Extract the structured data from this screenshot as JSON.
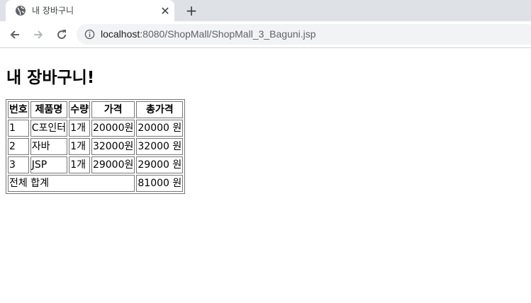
{
  "browser": {
    "tab": {
      "title": "내 장바구니"
    },
    "url": {
      "host": "localhost",
      "rest": ":8080/ShopMall/ShopMall_3_Baguni.jsp"
    }
  },
  "page": {
    "heading": "내 장바구니!",
    "table": {
      "headers": [
        "번호",
        "제품명",
        "수량",
        "가격",
        "총가격"
      ],
      "rows": [
        [
          "1",
          "C포인터",
          "1개",
          "20000원",
          "20000 원"
        ],
        [
          "2",
          "자바",
          "1개",
          "32000원",
          "32000 원"
        ],
        [
          "3",
          "JSP",
          "1개",
          "29000원",
          "29000 원"
        ]
      ],
      "total_label": "전체 합계",
      "total_value": "81000 원"
    }
  }
}
